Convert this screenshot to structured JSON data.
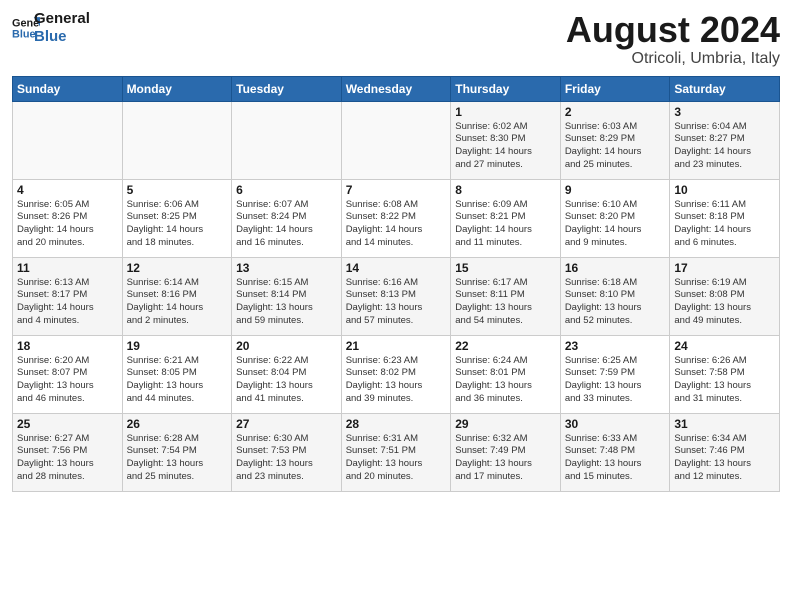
{
  "header": {
    "logo_line1": "General",
    "logo_line2": "Blue",
    "title": "August 2024",
    "subtitle": "Otricoli, Umbria, Italy"
  },
  "weekdays": [
    "Sunday",
    "Monday",
    "Tuesday",
    "Wednesday",
    "Thursday",
    "Friday",
    "Saturday"
  ],
  "weeks": [
    [
      {
        "day": "",
        "info": ""
      },
      {
        "day": "",
        "info": ""
      },
      {
        "day": "",
        "info": ""
      },
      {
        "day": "",
        "info": ""
      },
      {
        "day": "1",
        "info": "Sunrise: 6:02 AM\nSunset: 8:30 PM\nDaylight: 14 hours\nand 27 minutes."
      },
      {
        "day": "2",
        "info": "Sunrise: 6:03 AM\nSunset: 8:29 PM\nDaylight: 14 hours\nand 25 minutes."
      },
      {
        "day": "3",
        "info": "Sunrise: 6:04 AM\nSunset: 8:27 PM\nDaylight: 14 hours\nand 23 minutes."
      }
    ],
    [
      {
        "day": "4",
        "info": "Sunrise: 6:05 AM\nSunset: 8:26 PM\nDaylight: 14 hours\nand 20 minutes."
      },
      {
        "day": "5",
        "info": "Sunrise: 6:06 AM\nSunset: 8:25 PM\nDaylight: 14 hours\nand 18 minutes."
      },
      {
        "day": "6",
        "info": "Sunrise: 6:07 AM\nSunset: 8:24 PM\nDaylight: 14 hours\nand 16 minutes."
      },
      {
        "day": "7",
        "info": "Sunrise: 6:08 AM\nSunset: 8:22 PM\nDaylight: 14 hours\nand 14 minutes."
      },
      {
        "day": "8",
        "info": "Sunrise: 6:09 AM\nSunset: 8:21 PM\nDaylight: 14 hours\nand 11 minutes."
      },
      {
        "day": "9",
        "info": "Sunrise: 6:10 AM\nSunset: 8:20 PM\nDaylight: 14 hours\nand 9 minutes."
      },
      {
        "day": "10",
        "info": "Sunrise: 6:11 AM\nSunset: 8:18 PM\nDaylight: 14 hours\nand 6 minutes."
      }
    ],
    [
      {
        "day": "11",
        "info": "Sunrise: 6:13 AM\nSunset: 8:17 PM\nDaylight: 14 hours\nand 4 minutes."
      },
      {
        "day": "12",
        "info": "Sunrise: 6:14 AM\nSunset: 8:16 PM\nDaylight: 14 hours\nand 2 minutes."
      },
      {
        "day": "13",
        "info": "Sunrise: 6:15 AM\nSunset: 8:14 PM\nDaylight: 13 hours\nand 59 minutes."
      },
      {
        "day": "14",
        "info": "Sunrise: 6:16 AM\nSunset: 8:13 PM\nDaylight: 13 hours\nand 57 minutes."
      },
      {
        "day": "15",
        "info": "Sunrise: 6:17 AM\nSunset: 8:11 PM\nDaylight: 13 hours\nand 54 minutes."
      },
      {
        "day": "16",
        "info": "Sunrise: 6:18 AM\nSunset: 8:10 PM\nDaylight: 13 hours\nand 52 minutes."
      },
      {
        "day": "17",
        "info": "Sunrise: 6:19 AM\nSunset: 8:08 PM\nDaylight: 13 hours\nand 49 minutes."
      }
    ],
    [
      {
        "day": "18",
        "info": "Sunrise: 6:20 AM\nSunset: 8:07 PM\nDaylight: 13 hours\nand 46 minutes."
      },
      {
        "day": "19",
        "info": "Sunrise: 6:21 AM\nSunset: 8:05 PM\nDaylight: 13 hours\nand 44 minutes."
      },
      {
        "day": "20",
        "info": "Sunrise: 6:22 AM\nSunset: 8:04 PM\nDaylight: 13 hours\nand 41 minutes."
      },
      {
        "day": "21",
        "info": "Sunrise: 6:23 AM\nSunset: 8:02 PM\nDaylight: 13 hours\nand 39 minutes."
      },
      {
        "day": "22",
        "info": "Sunrise: 6:24 AM\nSunset: 8:01 PM\nDaylight: 13 hours\nand 36 minutes."
      },
      {
        "day": "23",
        "info": "Sunrise: 6:25 AM\nSunset: 7:59 PM\nDaylight: 13 hours\nand 33 minutes."
      },
      {
        "day": "24",
        "info": "Sunrise: 6:26 AM\nSunset: 7:58 PM\nDaylight: 13 hours\nand 31 minutes."
      }
    ],
    [
      {
        "day": "25",
        "info": "Sunrise: 6:27 AM\nSunset: 7:56 PM\nDaylight: 13 hours\nand 28 minutes."
      },
      {
        "day": "26",
        "info": "Sunrise: 6:28 AM\nSunset: 7:54 PM\nDaylight: 13 hours\nand 25 minutes."
      },
      {
        "day": "27",
        "info": "Sunrise: 6:30 AM\nSunset: 7:53 PM\nDaylight: 13 hours\nand 23 minutes."
      },
      {
        "day": "28",
        "info": "Sunrise: 6:31 AM\nSunset: 7:51 PM\nDaylight: 13 hours\nand 20 minutes."
      },
      {
        "day": "29",
        "info": "Sunrise: 6:32 AM\nSunset: 7:49 PM\nDaylight: 13 hours\nand 17 minutes."
      },
      {
        "day": "30",
        "info": "Sunrise: 6:33 AM\nSunset: 7:48 PM\nDaylight: 13 hours\nand 15 minutes."
      },
      {
        "day": "31",
        "info": "Sunrise: 6:34 AM\nSunset: 7:46 PM\nDaylight: 13 hours\nand 12 minutes."
      }
    ]
  ]
}
